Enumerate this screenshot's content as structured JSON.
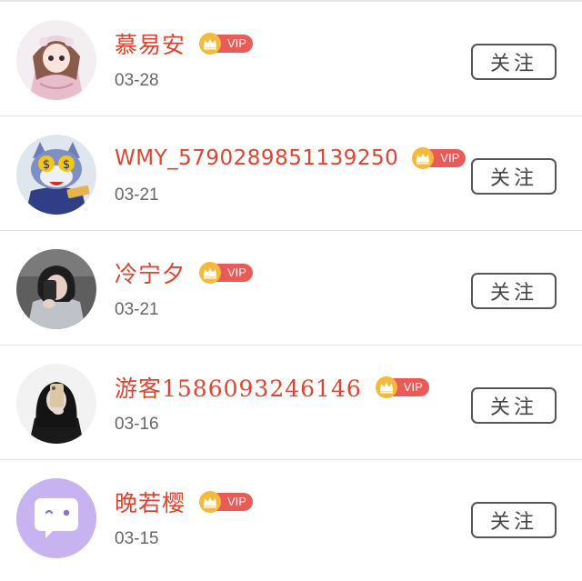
{
  "users": [
    {
      "name": "慕易安",
      "vip_label": "VIP",
      "date": "03-28",
      "follow_label": "关注",
      "avatar": "anime-girl-avatar"
    },
    {
      "name": "WMY_5790289851139250",
      "vip_label": "VIP",
      "date": "03-21",
      "follow_label": "关注",
      "avatar": "cartoon-cat-money-avatar"
    },
    {
      "name": "冷宁夕",
      "vip_label": "VIP",
      "date": "03-21",
      "follow_label": "关注",
      "avatar": "girl-phone-selfie-avatar"
    },
    {
      "name": "游客1586093246146",
      "vip_label": "VIP",
      "date": "03-16",
      "follow_label": "关注",
      "avatar": "girl-mirror-selfie-avatar"
    },
    {
      "name": "晚若樱",
      "vip_label": "VIP",
      "date": "03-15",
      "follow_label": "关注",
      "avatar": "chat-bubble-avatar"
    }
  ],
  "colors": {
    "name": "#e2432f",
    "vip_pill": "#ea5a57",
    "crown": "#f5b93b",
    "date": "#666666",
    "button_border": "#555555"
  }
}
